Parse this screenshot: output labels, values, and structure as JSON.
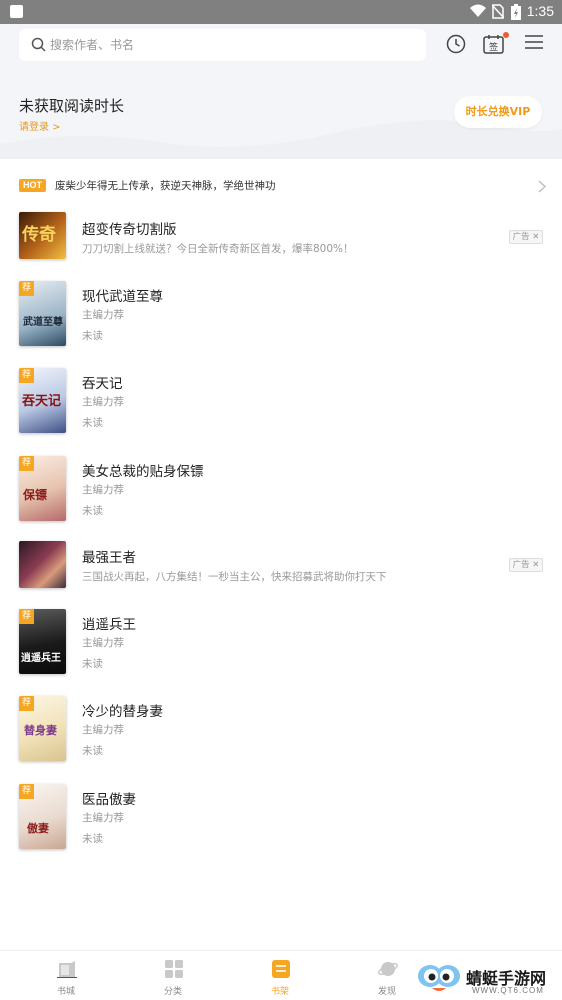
{
  "status_bar": {
    "time": "1:35"
  },
  "search": {
    "placeholder": "搜索作者、书名"
  },
  "header": {
    "reading_time": "未获取阅读时长",
    "login_link": "请登录 >",
    "vip_button": "时长兑换VIP",
    "sign_label": "签"
  },
  "hot": {
    "badge": "HOT",
    "text": "废柴少年得无上传承，获逆天神脉，学绝世神功"
  },
  "books": [
    {
      "title": "超变传奇切割版",
      "line1": "刀刀切割上线就送？今日全新传奇新区首发，爆率800%！",
      "ad": "广告 ✕",
      "cover_text": "传奇",
      "tag": ""
    },
    {
      "title": "现代武道至尊",
      "line1": "主编力荐",
      "line2": "未读",
      "cover_text": "武道至尊",
      "tag": "荐"
    },
    {
      "title": "吞天记",
      "line1": "主编力荐",
      "line2": "未读",
      "cover_text": "吞天记",
      "tag": "荐"
    },
    {
      "title": "美女总裁的贴身保镖",
      "line1": "主编力荐",
      "line2": "未读",
      "cover_text": "保镖",
      "tag": "荐"
    },
    {
      "title": "最强王者",
      "line1": "三国战火再起，八方集结！一秒当主公，快来招募武将助你打天下",
      "ad": "广告 ✕",
      "cover_text": "",
      "tag": ""
    },
    {
      "title": "逍遥兵王",
      "line1": "主编力荐",
      "line2": "未读",
      "cover_text": "逍遥兵王",
      "tag": "荐"
    },
    {
      "title": "冷少的替身妻",
      "line1": "主编力荐",
      "line2": "未读",
      "cover_text": "替身妻",
      "tag": "荐"
    },
    {
      "title": "医品傲妻",
      "line1": "主编力荐",
      "line2": "未读",
      "cover_text": "傲妻",
      "tag": "荐"
    }
  ],
  "nav": {
    "tabs": [
      {
        "label": "书城"
      },
      {
        "label": "分类"
      },
      {
        "label": "书架"
      },
      {
        "label": "发现"
      }
    ],
    "active_color": "#f5a623"
  },
  "watermark": {
    "name": "蜻蜓手游网",
    "url": "WWW.QT6.COM"
  }
}
